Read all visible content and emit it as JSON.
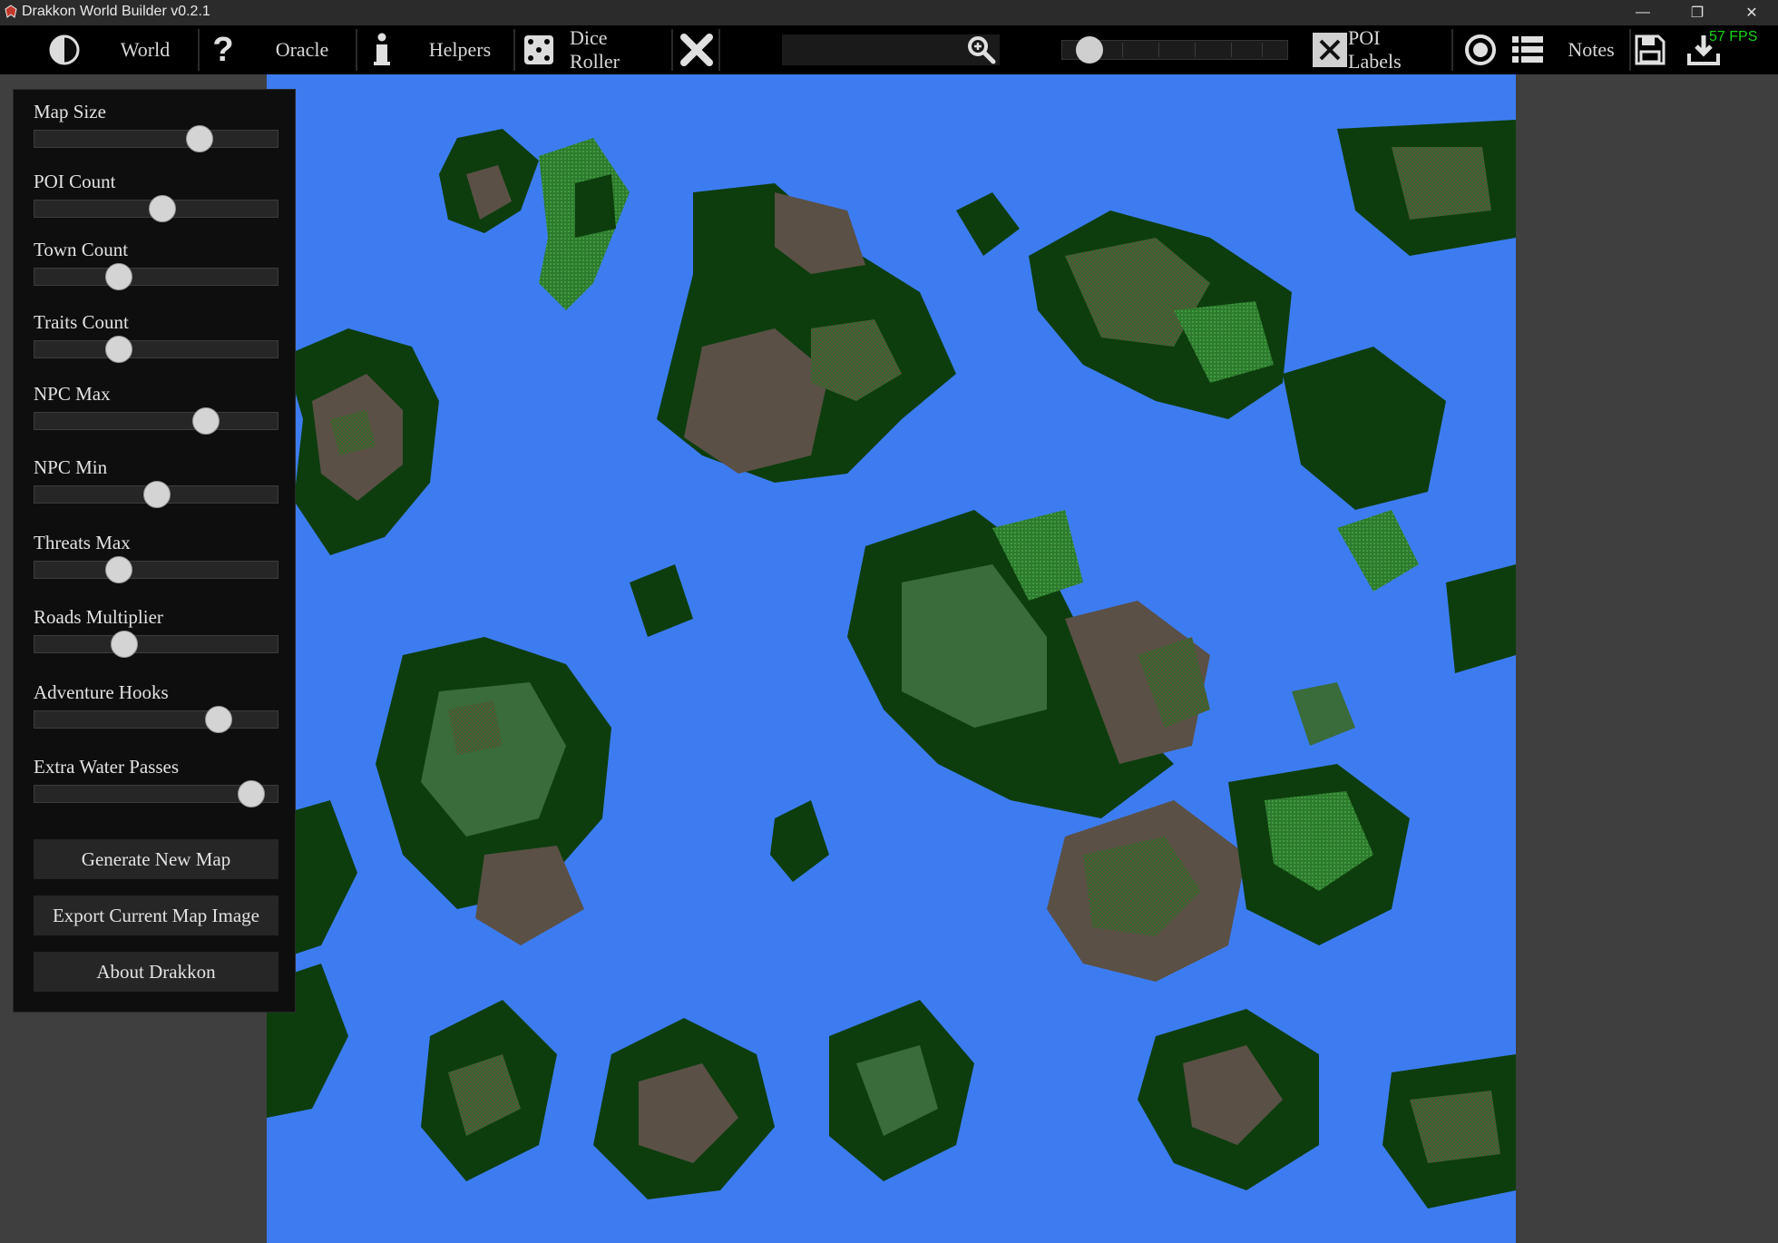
{
  "window": {
    "title": "Drakkon World Builder v0.2.1",
    "fps": "57 FPS"
  },
  "toolbar": {
    "world_label": "World",
    "oracle_label": "Oracle",
    "helpers_label": "Helpers",
    "dice_roller_label": "Dice Roller",
    "poi_labels_label": "POI Labels",
    "notes_label": "Notes",
    "search_value": "",
    "poi_labels_checked": true
  },
  "sliders": [
    {
      "label": "Map Size",
      "level": 0.68
    },
    {
      "label": "POI Count",
      "level": 0.53
    },
    {
      "label": "Town Count",
      "level": 0.35
    },
    {
      "label": "Traits Count",
      "level": 0.35
    },
    {
      "label": "NPC Max",
      "level": 0.71
    },
    {
      "label": "NPC Min",
      "level": 0.51
    },
    {
      "label": "Threats Max",
      "level": 0.35
    },
    {
      "label": "Roads Multiplier",
      "level": 0.37
    },
    {
      "label": "Adventure Hooks",
      "level": 0.76
    },
    {
      "label": "Extra Water Passes",
      "level": 0.89
    }
  ],
  "buttons": {
    "generate": "Generate New Map",
    "export": "Export Current Map Image",
    "about": "About Drakkon"
  },
  "colors": {
    "water": "#3d7cf0",
    "forest": "#0d3d0d",
    "grassland": "#3a6b3a",
    "hills": "#5a5046",
    "dry_plains": "#6b5a3c"
  }
}
